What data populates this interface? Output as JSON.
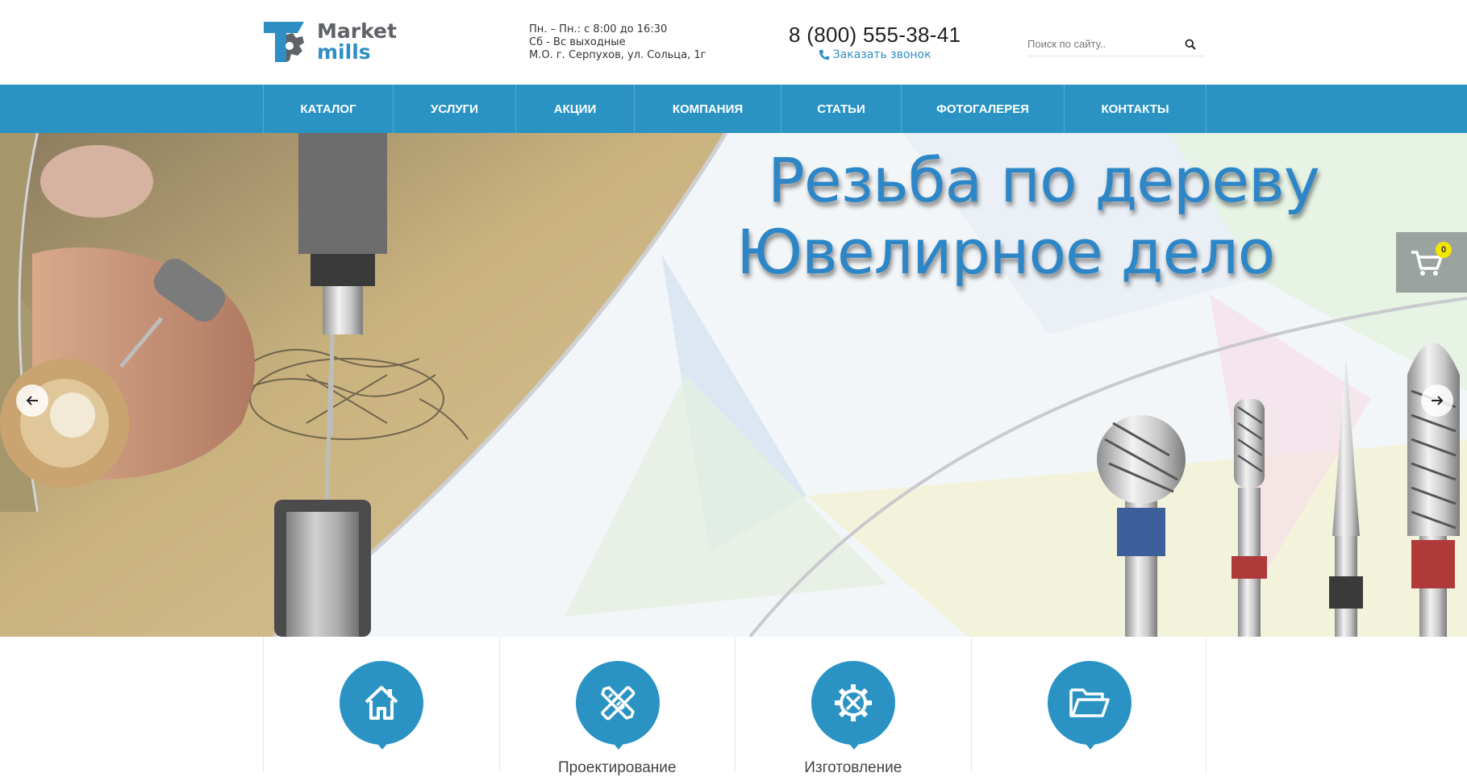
{
  "header": {
    "logo": {
      "line1": "Market",
      "line2": "mills"
    },
    "hours": {
      "line1": "Пн. – Пн.: с 8:00 до 16:30",
      "line2": "Сб - Вс выходные",
      "line3": "М.О. г. Серпухов, ул. Сольца, 1г"
    },
    "phone": "8 (800) 555-38-41",
    "callback_label": "Заказать звонок",
    "search": {
      "placeholder": "Поиск по сайту.."
    }
  },
  "nav": {
    "items": [
      {
        "label": "КАТАЛОГ"
      },
      {
        "label": "УСЛУГИ"
      },
      {
        "label": "АКЦИИ"
      },
      {
        "label": "КОМПАНИЯ"
      },
      {
        "label": "СТАТЬИ"
      },
      {
        "label": "ФОТОГАЛЕРЕЯ"
      },
      {
        "label": "КОНТАКТЫ"
      }
    ]
  },
  "hero": {
    "title_line1": "Резьба по дереву",
    "title_line2": "Ювелирное дело"
  },
  "cart": {
    "count": "0"
  },
  "features": [
    {
      "icon": "home-icon",
      "label": ""
    },
    {
      "icon": "pencil-ruler-icon",
      "label": "Проектирование"
    },
    {
      "icon": "gear-wrench-icon",
      "label": "Изготовление"
    },
    {
      "icon": "folder-open-icon",
      "label": ""
    }
  ],
  "colors": {
    "accent": "#2a93c4",
    "title": "#2c86c7",
    "badge": "#f3e600"
  }
}
